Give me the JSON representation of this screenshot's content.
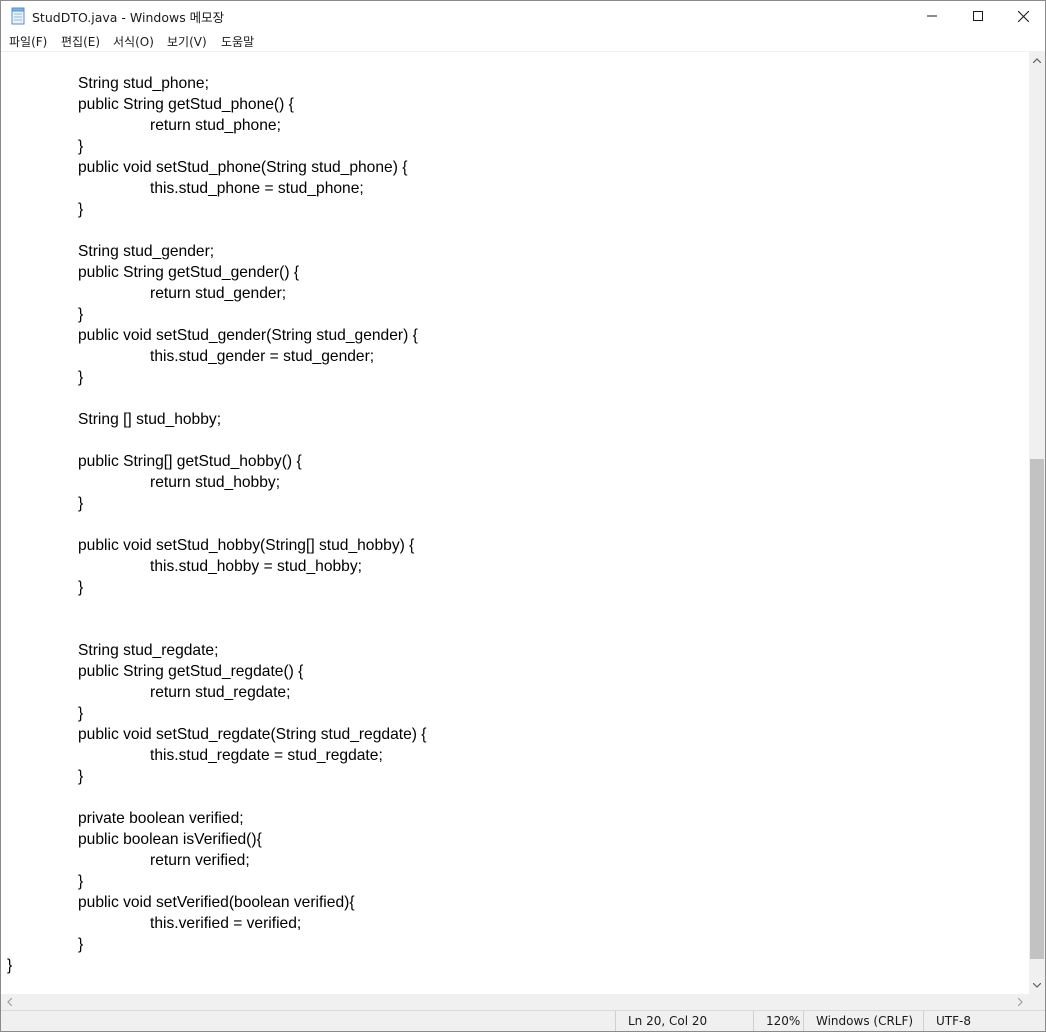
{
  "window": {
    "title": "StudDTO.java - Windows 메모장",
    "app_icon": "notepad-icon"
  },
  "menu": [
    "파일(F)",
    "편집(E)",
    "서식(O)",
    "보기(V)",
    "도움말"
  ],
  "editor": {
    "lines": [
      {
        "indent": 1,
        "text": "String stud_phone;"
      },
      {
        "indent": 1,
        "text": "public String getStud_phone() {"
      },
      {
        "indent": 2,
        "text": "return stud_phone;"
      },
      {
        "indent": 1,
        "text": "}"
      },
      {
        "indent": 1,
        "text": "public void setStud_phone(String stud_phone) {"
      },
      {
        "indent": 2,
        "text": "this.stud_phone = stud_phone;"
      },
      {
        "indent": 1,
        "text": "}"
      },
      {
        "indent": 0,
        "text": ""
      },
      {
        "indent": 1,
        "text": "String stud_gender;"
      },
      {
        "indent": 1,
        "text": "public String getStud_gender() {"
      },
      {
        "indent": 2,
        "text": "return stud_gender;"
      },
      {
        "indent": 1,
        "text": "}"
      },
      {
        "indent": 1,
        "text": "public void setStud_gender(String stud_gender) {"
      },
      {
        "indent": 2,
        "text": "this.stud_gender = stud_gender;"
      },
      {
        "indent": 1,
        "text": "}"
      },
      {
        "indent": 0,
        "text": ""
      },
      {
        "indent": 1,
        "text": "String [] stud_hobby;"
      },
      {
        "indent": 0,
        "text": ""
      },
      {
        "indent": 1,
        "text": "public String[] getStud_hobby() {"
      },
      {
        "indent": 2,
        "text": "return stud_hobby;"
      },
      {
        "indent": 1,
        "text": "}"
      },
      {
        "indent": 0,
        "text": ""
      },
      {
        "indent": 1,
        "text": "public void setStud_hobby(String[] stud_hobby) {"
      },
      {
        "indent": 2,
        "text": "this.stud_hobby = stud_hobby;"
      },
      {
        "indent": 1,
        "text": "}"
      },
      {
        "indent": 0,
        "text": ""
      },
      {
        "indent": 0,
        "text": ""
      },
      {
        "indent": 1,
        "text": "String stud_regdate;"
      },
      {
        "indent": 1,
        "text": "public String getStud_regdate() {"
      },
      {
        "indent": 2,
        "text": "return stud_regdate;"
      },
      {
        "indent": 1,
        "text": "}"
      },
      {
        "indent": 1,
        "text": "public void setStud_regdate(String stud_regdate) {"
      },
      {
        "indent": 2,
        "text": "this.stud_regdate = stud_regdate;"
      },
      {
        "indent": 1,
        "text": "}"
      },
      {
        "indent": 0,
        "text": ""
      },
      {
        "indent": 1,
        "text": "private boolean verified;"
      },
      {
        "indent": 1,
        "text": "public boolean isVerified(){"
      },
      {
        "indent": 2,
        "text": "return verified;"
      },
      {
        "indent": 1,
        "text": "}"
      },
      {
        "indent": 1,
        "text": "public void setVerified(boolean verified){"
      },
      {
        "indent": 2,
        "text": "this.verified = verified;"
      },
      {
        "indent": 1,
        "text": "}"
      },
      {
        "indent": 0,
        "text": "}"
      }
    ]
  },
  "status": {
    "position": "Ln 20, Col 20",
    "zoom": "120%",
    "line_ending": "Windows (CRLF)",
    "encoding": "UTF-8"
  }
}
